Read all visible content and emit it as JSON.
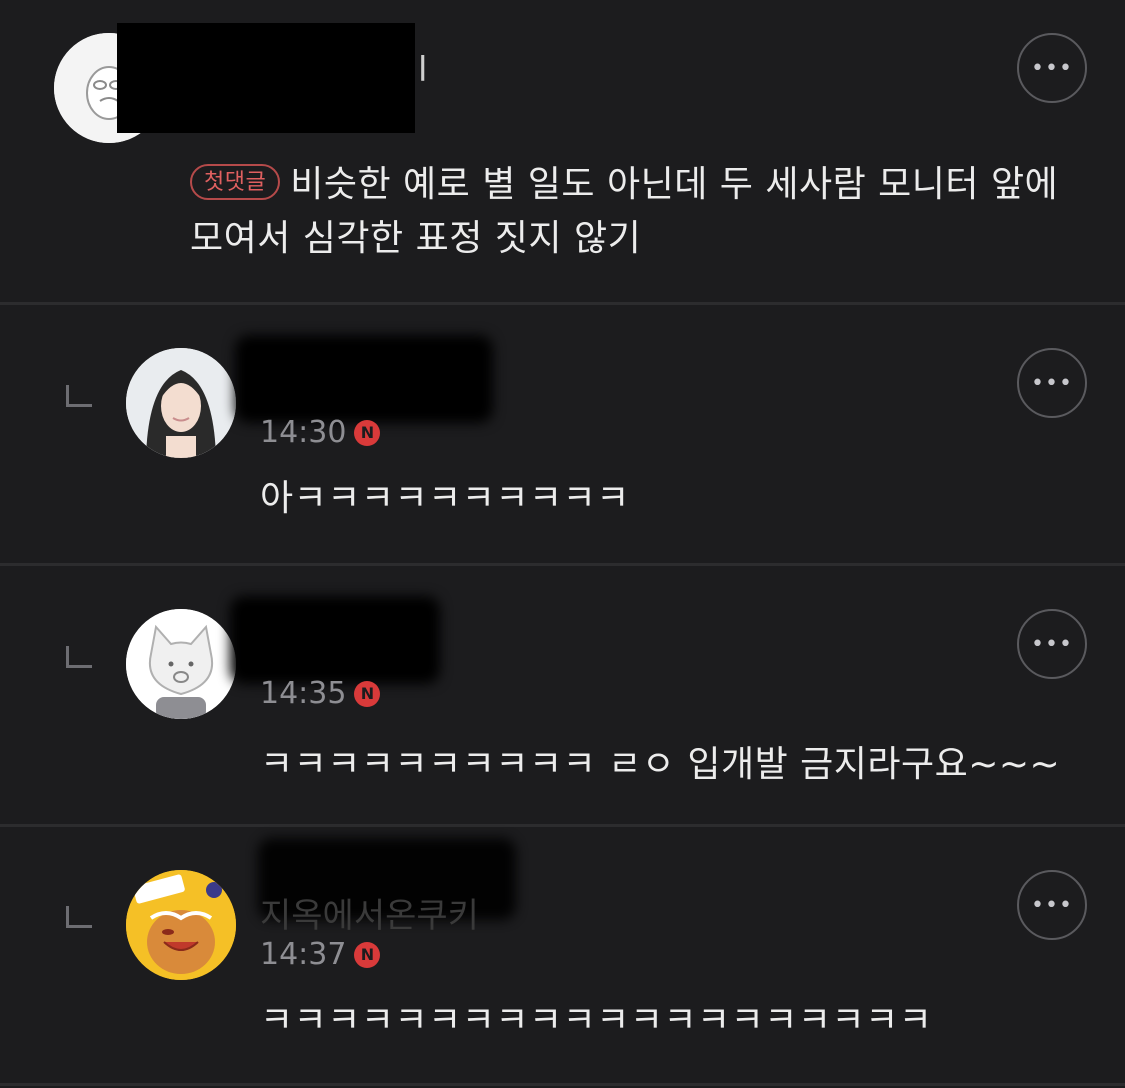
{
  "comments": [
    {
      "name_visible_fragment": "l",
      "time": "",
      "first_badge": "첫댓글",
      "text": "비슷한 예로 별 일도 아닌데 두 세사람 모니터 앞에 모여서 심각한 표정 짓지 않기",
      "more": "•••"
    },
    {
      "name_visible_fragment": "",
      "time": "14:30",
      "badge": "N",
      "text": "아ㅋㅋㅋㅋㅋㅋㅋㅋㅋㅋ",
      "more": "•••"
    },
    {
      "name_visible_fragment": "",
      "time": "14:35",
      "badge": "N",
      "text": "ㅋㅋㅋㅋㅋㅋㅋㅋㅋㅋ ㄹㅇ 입개발 금지라구요~~~",
      "more": "•••"
    },
    {
      "name_visible_fragment": "지옥에서온쿠키",
      "time": "14:37",
      "badge": "N",
      "text": "ㅋㅋㅋㅋㅋㅋㅋㅋㅋㅋㅋㅋㅋㅋㅋㅋㅋㅋㅋㅋ",
      "more": "•••"
    }
  ],
  "colors": {
    "background": "#1c1c1e",
    "badge_red": "#d93a3a",
    "first_badge_border": "#b54a4a"
  },
  "icons": [
    "more-icon",
    "reply-arrow-icon",
    "avatar-cartoon-icon",
    "avatar-photo-icon",
    "avatar-cat-icon",
    "avatar-cookie-icon"
  ]
}
